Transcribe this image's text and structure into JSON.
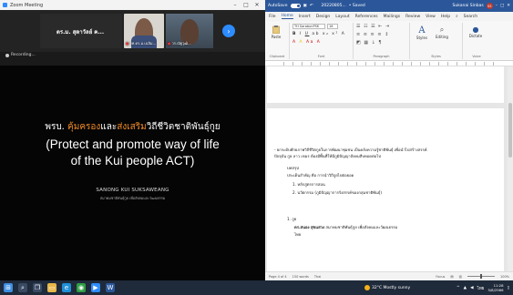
{
  "zoom": {
    "window_title": "Zoom Meeting",
    "tiles": [
      {
        "name": "ดร.ม. สุดาวัลย์ ค...",
        "label": "ดร.ม. สุดาวัลย์ ค..."
      },
      {
        "label": "รศ.ดร.ม.เฉลิม..."
      },
      {
        "label": "วร.ณัฐวุฒิ..."
      }
    ],
    "recording_label": "Recording...",
    "slide": {
      "title_th_prefix": "พรบ. ",
      "title_th_orange1": "คุ้มครอง",
      "title_th_mid": "และ",
      "title_th_orange2": "ส่งเสริม",
      "title_th_suffix": "วิถีชีวิตชาติพันธุ์กูย",
      "title_en_line1": "(Protect and promote way of life",
      "title_en_line2": "of the Kui people ACT)",
      "presenter": "SANONG KUI SUKSAWEANG",
      "affiliation": "สมาคมชาติพันธุ์กูย เพื่อสังคมและวัฒนธรรม"
    }
  },
  "word": {
    "autosave_label": "AutoSave",
    "file_name": "20220805...",
    "saved_status": "• Saved",
    "user_name": "Sukanai Sinbas",
    "user_badge": "SS",
    "tabs": [
      "File",
      "Home",
      "Insert",
      "Design",
      "Layout",
      "References",
      "Mailings",
      "Review",
      "View",
      "Help",
      "Search"
    ],
    "active_tab": "Home",
    "ribbon": {
      "paste_label": "Paste",
      "clipboard_label": "Clipboard",
      "font_name": "TH SarabunPSK",
      "font_size": "16",
      "font_label": "Font",
      "paragraph_label": "Paragraph",
      "styles_label": "Styles",
      "editing_label": "Editing",
      "dictate_label": "Dictate",
      "styles_group_label": "Styles",
      "voice_label": "Voice"
    },
    "doc_lines": [
      "- ยกระดับศักยภาพวิถีชีวิตกูยในการพัฒนาชุมชน เป็นคลังความรู้ชาติพันธุ์ เพื่อนำไปสร้างสรรค์",
      "ปัจจุบัน กูย ลาว เขมร ต้องมีพื้นที่ให้มีภูมิปัญญาสังคมสืบทอดต่อไป",
      "บทสรุป",
      "ประเด็นสำคัญ คือ การนำวิถีกูยไปต่อยอด",
      "1.   หลักสูตรการสอน",
      "2.   นวัตกรรม (ภูมิปัญญาการรังสรรค์ของกลุ่มชาติพันธุ์)",
      "1.   กูย",
      "ดร.สนอง สุขแสวง",
      "สมาคมชาติพันธุ์กูย เพื่อสังคมและวัฒนธรรม",
      "ไทย"
    ],
    "status": {
      "page": "Page 4 of 4",
      "words": "150 words",
      "lang": "Thai",
      "focus": "Focus",
      "zoom": "100%"
    }
  },
  "taskbar": {
    "weather": "32°C  Mostly sunny",
    "lang": "ไทย",
    "time": "11:28",
    "date": "5/8/2566"
  }
}
